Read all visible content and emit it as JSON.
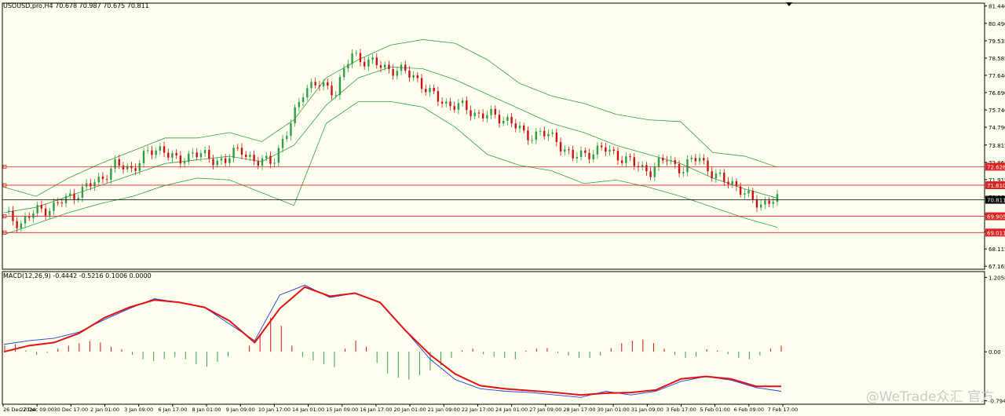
{
  "symbol_header": "USOUSD,pro,H4  70.678 70.987 70.675 70.811",
  "macd_header": "MACD(12,26,9) -0.4442 -0.5216 0.1006 0.0000",
  "watermark": "@WeTrade众汇 官方",
  "colors": {
    "background": "#fffff0",
    "bull": "#2e9e44",
    "bear": "#cc1111",
    "bands": "#2e9e44",
    "hline": "#dd2222",
    "macd_line": "#1f3bdc",
    "signal_line": "#e01010"
  },
  "chart_data": [
    {
      "type": "candlestick",
      "title": "USOUSD,pro,H4",
      "ylim": [
        67.0,
        81.6
      ],
      "y_ticks": [
        "81.440",
        "80.490",
        "79.535",
        "78.585",
        "77.640",
        "76.690",
        "75.740",
        "74.790",
        "73.815",
        "72.865",
        "71.915",
        "70.960",
        "70.011",
        "69.061",
        "68.115",
        "67.165"
      ],
      "x_ticks": [
        "26 Dec 2024",
        "27 Dec 09:00",
        "30 Dec 17:00",
        "2 Jan 01:00",
        "3 Jan 09:00",
        "6 Jan 17:00",
        "8 Jan 01:00",
        "9 Jan 09:00",
        "10 Jan 17:00",
        "14 Jan 01:00",
        "15 Jan 09:00",
        "16 Jan 17:00",
        "20 Jan 01:00",
        "21 Jan 09:00",
        "22 Jan 17:00",
        "24 Jan 01:00",
        "27 Jan 09:00",
        "28 Jan 17:00",
        "30 Jan 01:00",
        "31 Jan 09:00",
        "3 Feb 17:00",
        "5 Feb 01:00",
        "6 Feb 09:00",
        "7 Feb 17:00"
      ],
      "close_anchors": [
        70.0,
        69.5,
        70.2,
        70.4,
        70.9,
        71.4,
        71.9,
        72.7,
        72.5,
        73.3,
        73.7,
        72.8,
        73.5,
        73.0,
        73.0,
        73.6,
        72.8,
        73.0,
        74.6,
        77.0,
        77.1,
        76.8,
        78.8,
        78.4,
        78.1,
        77.9,
        77.6,
        76.6,
        76.1,
        75.9,
        75.5,
        75.4,
        75.2,
        74.3,
        74.5,
        74.1,
        73.1,
        73.4,
        73.6,
        73.2,
        72.7,
        72.4,
        73.1,
        72.4,
        73.3,
        72.0,
        71.9,
        71.0,
        70.6,
        70.8
      ],
      "price_label": "70.811",
      "price_level": 70.811,
      "horizontal_lines": [
        {
          "label": "72.626",
          "value": 72.626
        },
        {
          "label": "71.610",
          "value": 71.61
        },
        {
          "label": "69.905",
          "value": 69.905
        },
        {
          "label": "69.011",
          "value": 69.011
        }
      ],
      "bollinger": {
        "upper": [
          71.5,
          71.0,
          72.0,
          72.8,
          73.5,
          74.2,
          74.2,
          74.5,
          74.0,
          75.2,
          77.5,
          78.5,
          79.3,
          79.6,
          79.4,
          78.5,
          77.2,
          76.5,
          76.1,
          75.5,
          75.2,
          75.1,
          73.4,
          73.2,
          72.6
        ],
        "mid": [
          70.1,
          70.4,
          71.0,
          71.6,
          72.2,
          72.8,
          73.0,
          73.2,
          72.9,
          73.8,
          76.0,
          77.5,
          78.1,
          78.0,
          77.4,
          76.6,
          75.8,
          75.0,
          74.5,
          73.8,
          73.3,
          72.8,
          72.0,
          71.4,
          70.9
        ],
        "lower": [
          68.9,
          69.5,
          70.1,
          70.6,
          71.0,
          71.6,
          72.0,
          71.9,
          71.2,
          70.5,
          75.0,
          76.2,
          76.2,
          75.9,
          74.8,
          73.3,
          72.7,
          72.4,
          71.7,
          71.9,
          71.5,
          71.0,
          70.4,
          69.8,
          69.3
        ]
      }
    },
    {
      "type": "line",
      "title": "MACD(12,26,9)",
      "ylim": [
        -0.85,
        1.3
      ],
      "y_ticks": [
        "1.2058",
        "0.00",
        "-0.7941"
      ],
      "series": [
        {
          "name": "MACD",
          "values": [
            0.12,
            0.18,
            0.22,
            0.32,
            0.52,
            0.7,
            0.86,
            0.8,
            0.72,
            0.45,
            0.18,
            0.92,
            1.08,
            0.88,
            0.95,
            0.8,
            0.35,
            -0.12,
            -0.45,
            -0.6,
            -0.64,
            -0.66,
            -0.7,
            -0.74,
            -0.64,
            -0.7,
            -0.64,
            -0.48,
            -0.4,
            -0.46,
            -0.58,
            -0.64
          ]
        },
        {
          "name": "Signal",
          "values": [
            0.0,
            0.1,
            0.15,
            0.3,
            0.55,
            0.72,
            0.84,
            0.8,
            0.72,
            0.5,
            0.15,
            0.7,
            1.05,
            0.9,
            0.95,
            0.8,
            0.35,
            -0.05,
            -0.36,
            -0.55,
            -0.6,
            -0.63,
            -0.66,
            -0.7,
            -0.67,
            -0.66,
            -0.62,
            -0.44,
            -0.4,
            -0.44,
            -0.56,
            -0.56
          ]
        }
      ],
      "histogram": [
        0.1,
        0.12,
        0.02,
        -0.05,
        -0.02,
        0.05,
        0.1,
        0.14,
        0.17,
        0.15,
        0.08,
        0.04,
        -0.05,
        -0.12,
        -0.15,
        -0.12,
        -0.08,
        -0.12,
        -0.2,
        -0.24,
        -0.16,
        -0.08,
        0.0,
        0.1,
        0.25,
        0.55,
        0.42,
        0.1,
        -0.08,
        -0.14,
        -0.2,
        -0.25,
        0.05,
        0.18,
        0.08,
        -0.18,
        -0.35,
        -0.42,
        -0.45,
        -0.38,
        -0.3,
        -0.22,
        -0.1,
        0.02,
        0.05,
        -0.04,
        -0.08,
        -0.1,
        -0.12,
        0.02,
        0.05,
        0.06,
        -0.02,
        -0.06,
        -0.1,
        -0.1,
        -0.06,
        0.06,
        0.14,
        0.18,
        0.2,
        0.14,
        0.05,
        -0.05,
        -0.1,
        -0.08,
        0.04,
        0.02,
        -0.04,
        -0.1,
        -0.12,
        -0.06,
        0.05,
        0.1
      ]
    }
  ]
}
